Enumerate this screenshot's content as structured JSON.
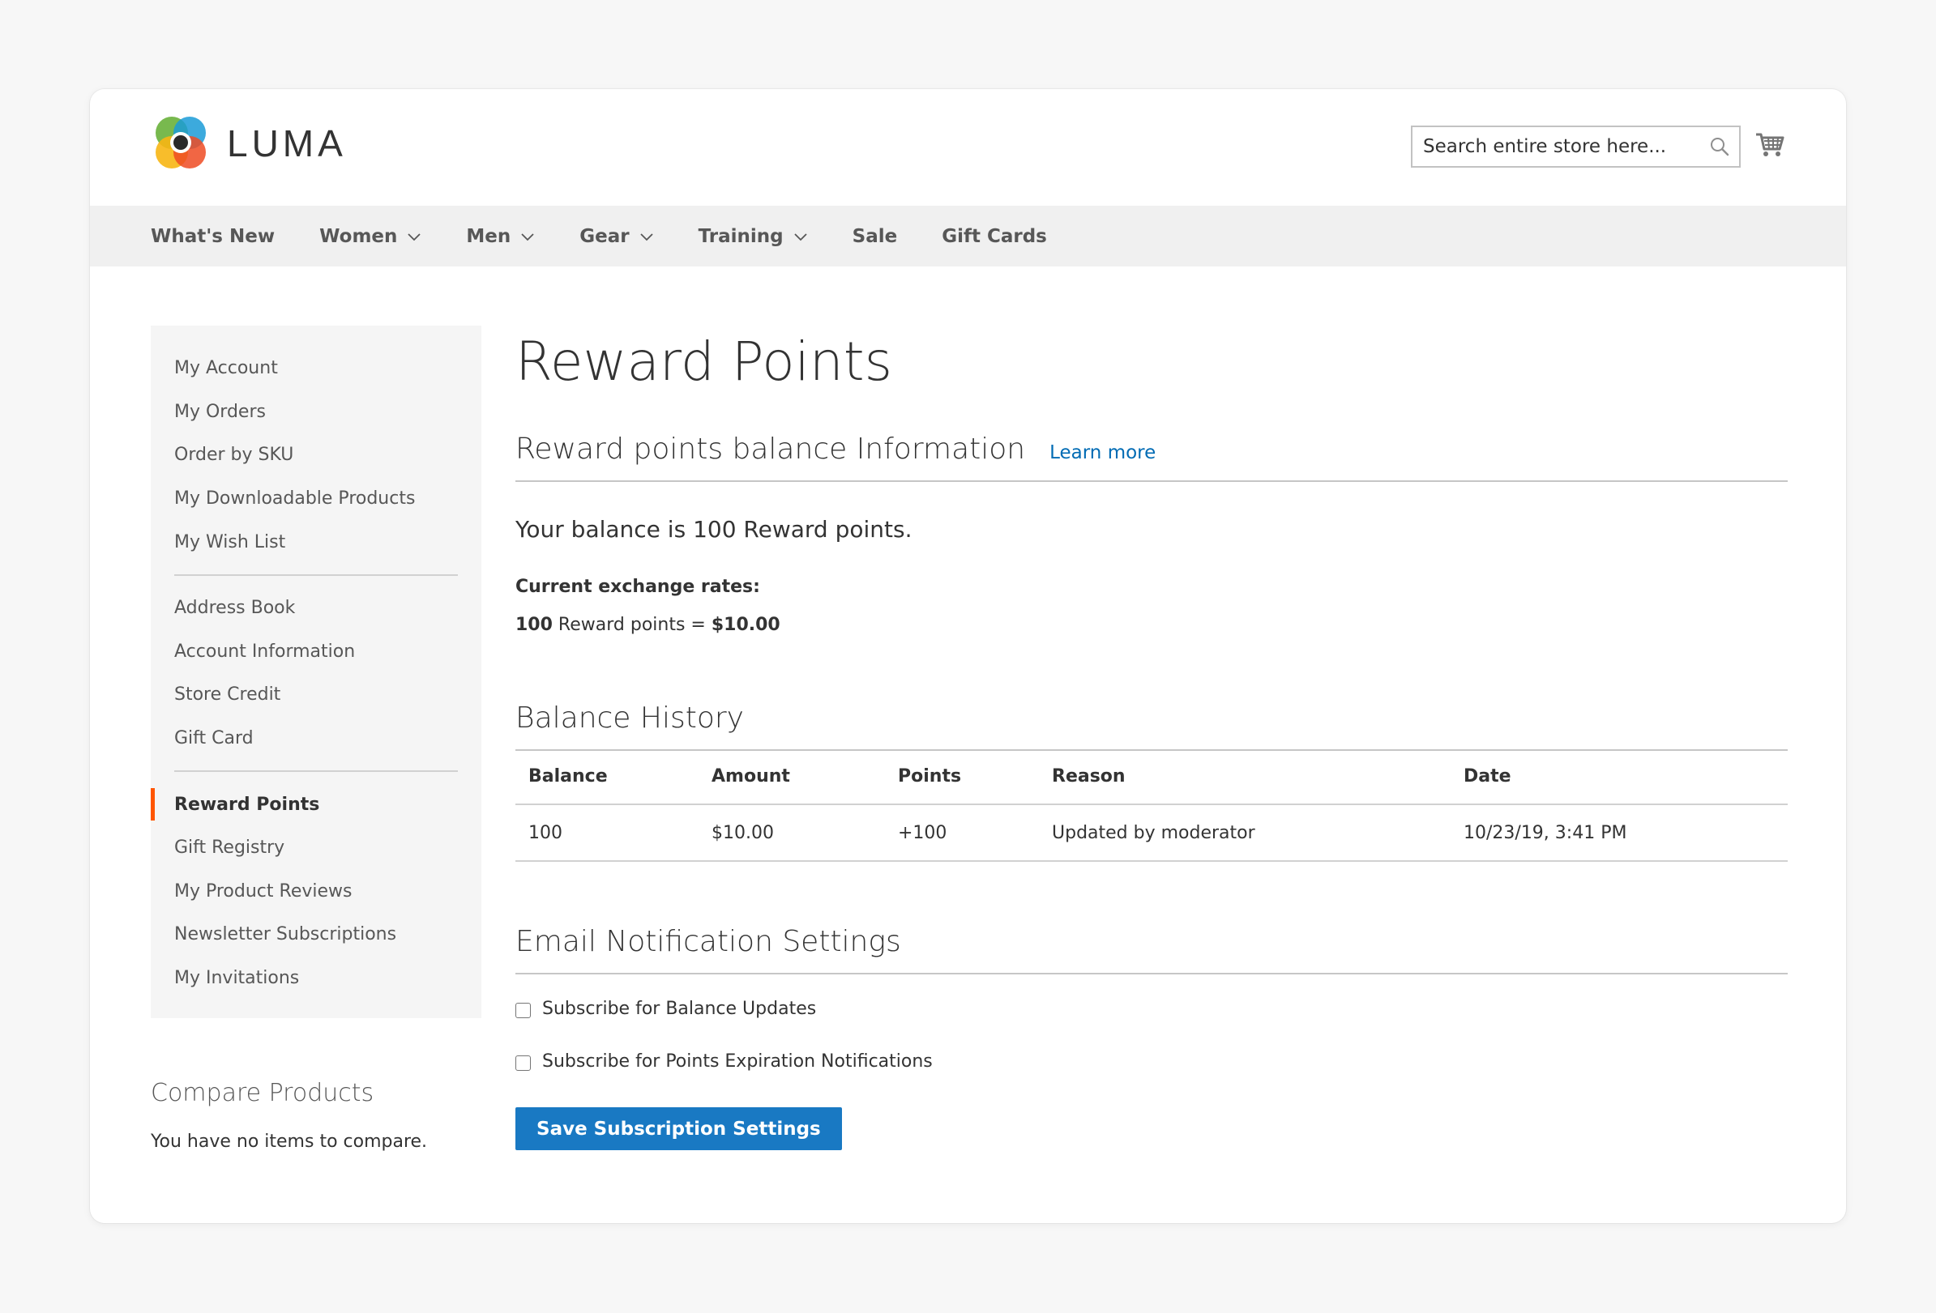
{
  "brand": {
    "name": "LUMA"
  },
  "search": {
    "placeholder": "Search entire store here..."
  },
  "nav": {
    "items": [
      {
        "label": "What's New",
        "dropdown": false
      },
      {
        "label": "Women",
        "dropdown": true
      },
      {
        "label": "Men",
        "dropdown": true
      },
      {
        "label": "Gear",
        "dropdown": true
      },
      {
        "label": "Training",
        "dropdown": true
      },
      {
        "label": "Sale",
        "dropdown": false
      },
      {
        "label": "Gift Cards",
        "dropdown": false
      }
    ]
  },
  "sidebar": {
    "groups": [
      [
        "My Account",
        "My Orders",
        "Order by SKU",
        "My Downloadable Products",
        "My Wish List"
      ],
      [
        "Address Book",
        "Account Information",
        "Store Credit",
        "Gift Card"
      ],
      [
        "Reward Points",
        "Gift Registry",
        "My Product Reviews",
        "Newsletter Subscriptions",
        "My Invitations"
      ]
    ],
    "active": "Reward Points",
    "active_color": "#ff5501"
  },
  "compare": {
    "title": "Compare Products",
    "empty_text": "You have no items to compare."
  },
  "main": {
    "title": "Reward Points",
    "balance_section": {
      "title": "Reward points balance Information",
      "learn_more": "Learn more",
      "balance_text": "Your balance is 100 Reward points.",
      "rates_label": "Current exchange rates:",
      "rate_points": "100",
      "rate_middle": " Reward points = ",
      "rate_value": "$10.00"
    },
    "history": {
      "title": "Balance History",
      "columns": [
        "Balance",
        "Amount",
        "Points",
        "Reason",
        "Date"
      ],
      "rows": [
        [
          "100",
          "$10.00",
          "+100",
          "Updated by moderator",
          "10/23/19, 3:41 PM"
        ]
      ]
    },
    "email": {
      "title": "Email Notification Settings",
      "options": [
        {
          "label": "Subscribe for Balance Updates",
          "checked": false
        },
        {
          "label": "Subscribe for Points Expiration Notifications",
          "checked": false
        }
      ],
      "save_label": "Save Subscription Settings"
    }
  },
  "colors": {
    "link": "#006bb4",
    "primary_button": "#1979c3",
    "nav_bg": "#f0f0f0",
    "sidebar_bg": "#f5f5f5"
  }
}
